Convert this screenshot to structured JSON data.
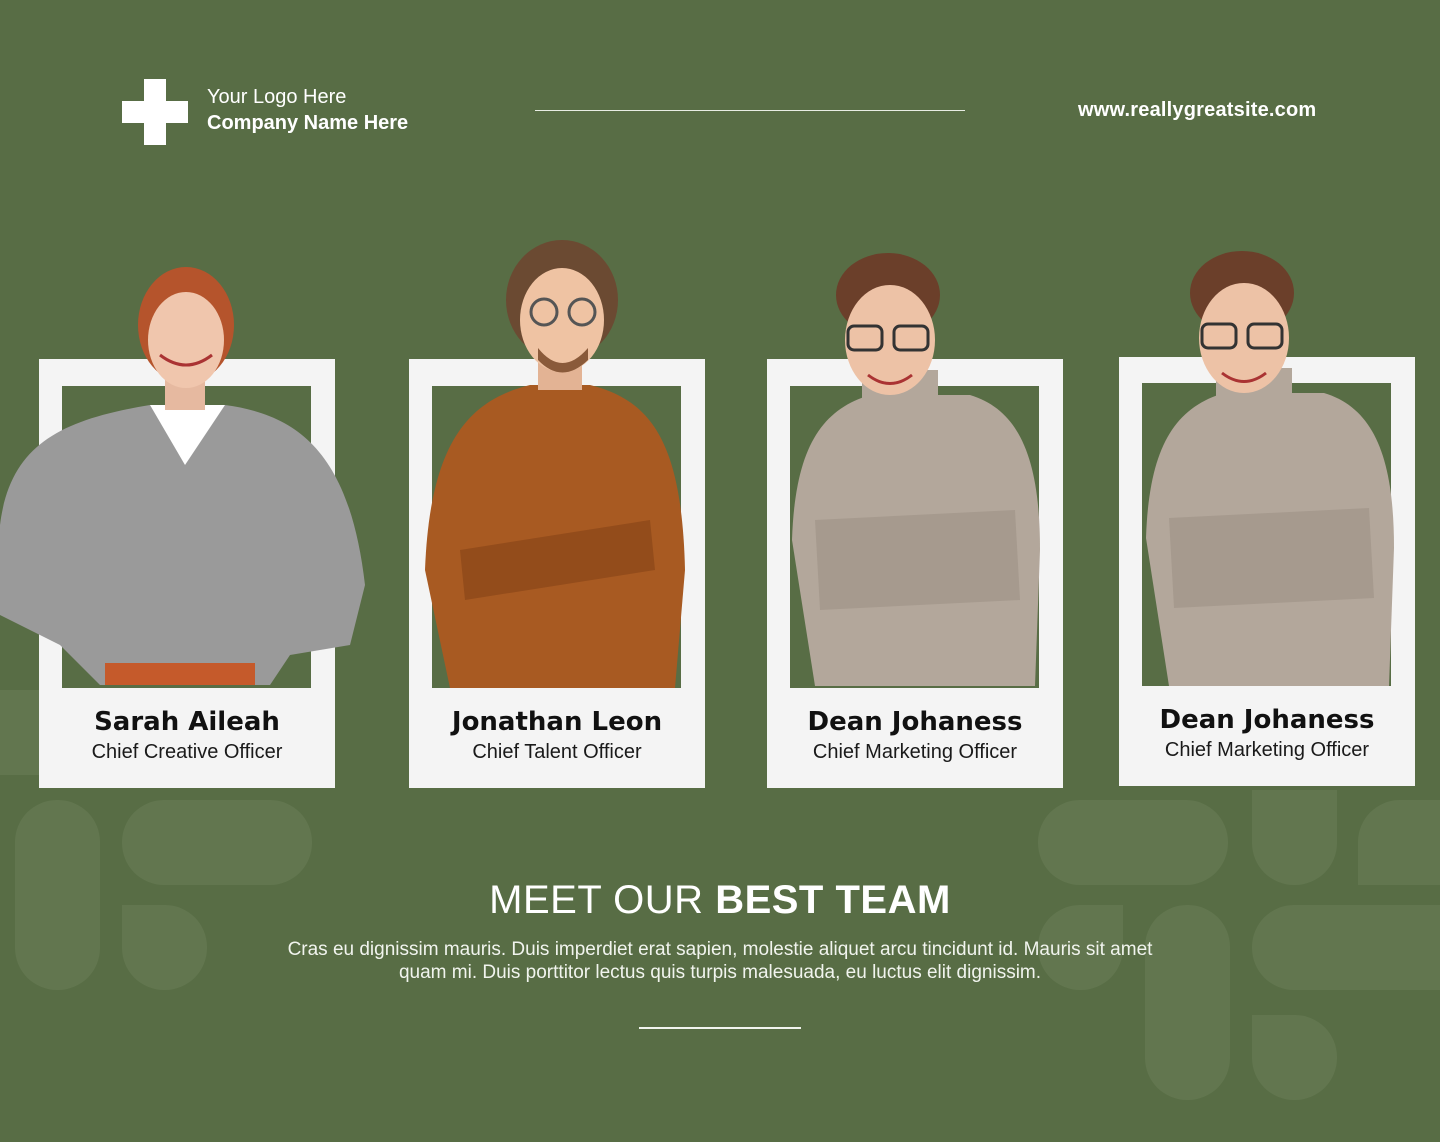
{
  "header": {
    "logo_line1": "Your Logo Here",
    "logo_line2": "Company Name Here",
    "website": "www.reallygreatsite.com"
  },
  "team": [
    {
      "name": "Sarah Aileah",
      "role": "Chief Creative Officer",
      "sweater_color": "#9c9c9c"
    },
    {
      "name": "Jonathan Leon",
      "role": "Chief Talent Officer",
      "sweater_color": "#a85a22"
    },
    {
      "name": "Dean Johaness",
      "role": "Chief Marketing Officer",
      "sweater_color": "#b3a79b"
    },
    {
      "name": "Dean Johaness",
      "role": "Chief Marketing Officer",
      "sweater_color": "#b3a79b"
    }
  ],
  "headline": {
    "light": "MEET OUR ",
    "bold": "BEST TEAM"
  },
  "description": "Cras eu dignissim mauris. Duis imperdiet erat sapien, molestie aliquet arcu tincidunt id. Mauris sit amet quam mi. Duis porttitor lectus quis turpis malesuada, eu luctus elit dignissim.",
  "colors": {
    "background": "#586d45",
    "card": "#f4f4f4",
    "decor": "#657a53"
  }
}
